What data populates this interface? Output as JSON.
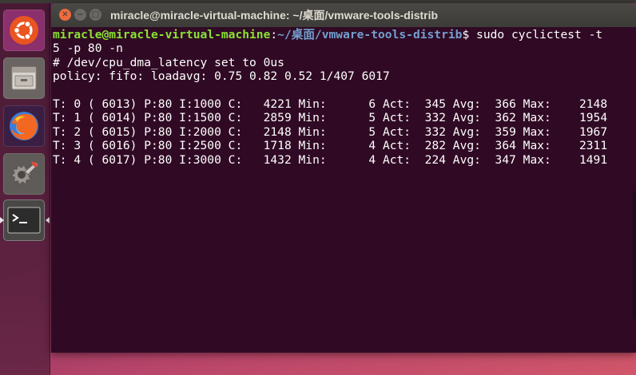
{
  "window": {
    "title": "miracle@miracle-virtual-machine: ~/桌面/vmware-tools-distrib",
    "controls": {
      "close": "✕",
      "minimize": "−",
      "maximize": "□"
    }
  },
  "launcher": {
    "items": [
      {
        "icon": "ubuntu-icon"
      },
      {
        "icon": "files-icon"
      },
      {
        "icon": "firefox-icon"
      },
      {
        "icon": "settings-icon"
      },
      {
        "icon": "terminal-icon",
        "active": true
      }
    ]
  },
  "terminal": {
    "prompt": {
      "user_host": "miracle@miracle-virtual-machine",
      "colon": ":",
      "path": "~/桌面/vmware-tools-distrib",
      "symbol": "$",
      "command": " sudo cyclictest -t"
    },
    "command_wrap": "5 -p 80 -n",
    "output_lines": [
      "# /dev/cpu_dma_latency set to 0us",
      "policy: fifo: loadavg: 0.75 0.82 0.52 1/407 6017",
      "",
      "T: 0 ( 6013) P:80 I:1000 C:   4221 Min:      6 Act:  345 Avg:  366 Max:    2148",
      "T: 1 ( 6014) P:80 I:1500 C:   2859 Min:      5 Act:  332 Avg:  362 Max:    1954",
      "T: 2 ( 6015) P:80 I:2000 C:   2148 Min:      5 Act:  332 Avg:  359 Max:    1967",
      "T: 3 ( 6016) P:80 I:2500 C:   1718 Min:      4 Act:  282 Avg:  364 Max:    2311",
      "T: 4 ( 6017) P:80 I:3000 C:   1432 Min:      4 Act:  224 Avg:  347 Max:    1491"
    ],
    "colors": {
      "background": "#300a24",
      "user": "#8ae234",
      "path": "#729fcf",
      "text": "#ffffff"
    }
  }
}
